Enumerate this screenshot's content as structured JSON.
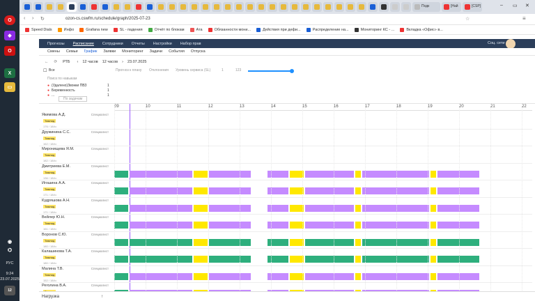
{
  "taskbar": {
    "lang": "РУС",
    "time": "9:24",
    "date": "23.07.2025",
    "notif": "12"
  },
  "browser": {
    "url": "ozon-cs.cswfm.ru/schedule/graph/2025-07-23",
    "tab_title_1": "Подк",
    "tab_title_2": "[Най",
    "tab_title_3": "[CSP]",
    "bookmarks": [
      {
        "label": "Speed Dials",
        "color": "#e33"
      },
      {
        "label": "Инфо",
        "color": "#f90"
      },
      {
        "label": "Grafana new",
        "color": "#f60"
      },
      {
        "label": "SL - падения",
        "color": "#e33"
      },
      {
        "label": "Отчёт по блокам",
        "color": "#4a4"
      },
      {
        "label": "Ата",
        "color": "#e55"
      },
      {
        "label": "Обязанности мони...",
        "color": "#e33"
      },
      {
        "label": "Действия при дефи...",
        "color": "#1a5fd6"
      },
      {
        "label": "Распределение на...",
        "color": "#1a5fd6"
      },
      {
        "label": "Мониторинг КС - ...",
        "color": "#333"
      },
      {
        "label": "Вкладка «Офис» в...",
        "color": "#e33"
      }
    ]
  },
  "app": {
    "nav": [
      "Прогнозы",
      "Расписание",
      "Сотрудники",
      "Отчеты",
      "Настройки",
      "Набор прав"
    ],
    "user": "Соц. сети",
    "menu": [
      "Смены",
      "Семьи",
      "График",
      "Заявки",
      "Мониторинг",
      "Задачи",
      "События",
      "Отпуска"
    ],
    "toolbar": {
      "rtb": "РТБ",
      "hours_a": "12 часов",
      "hours_b": "12 часов",
      "date": "23.07.2025"
    },
    "filters": {
      "all": "Все",
      "search_placeholder": "Поиск по навыкам",
      "forecast": "Прогноз к плану",
      "deviations": "Отклонения",
      "service": "Уровень сервиса (SL)",
      "opt1": "1",
      "opt2": "123",
      "items": [
        {
          "label": "(Удалено)Звонки ПВЗ",
          "count": "1"
        },
        {
          "label": "Беременность",
          "count": "1"
        },
        {
          "label": "...",
          "count": "1"
        }
      ],
      "search": "По задачам"
    },
    "hours": [
      "09",
      "10",
      "11",
      "12",
      "13",
      "14",
      "15",
      "16",
      "17",
      "18",
      "19",
      "20",
      "21",
      "22"
    ],
    "employees": [
      {
        "name": "Якимова А.Д.",
        "tag": "Тимлид",
        "meta": "176 / 184ч",
        "role": "Специалист"
      },
      {
        "name": "Дружинина С.С.",
        "tag": "Тимлид",
        "meta": "162 / 184ч",
        "role": "Специалист"
      },
      {
        "name": "Миронищева Я.М.",
        "tag": "Тимлид",
        "meta": "182 / 184ч",
        "role": "Специалист"
      },
      {
        "name": "Дмитриева Е.М.",
        "tag": "Тимлид",
        "meta": "136 / 184ч",
        "role": "Специалист"
      },
      {
        "name": "Игошина А.А.",
        "tag": "Тимлид",
        "meta": "171 / 184ч",
        "role": "Специалист"
      },
      {
        "name": "Кудряшова А.Н.",
        "tag": "Тимлид",
        "meta": "171 / 184ч",
        "role": "Специалист"
      },
      {
        "name": "Вейлер Ю.Н.",
        "tag": "Тимлид",
        "meta": "161 / 184ч",
        "role": "Специалист"
      },
      {
        "name": "Воронов С.Ю.",
        "tag": "Тимлид",
        "meta": "180 / 184ч",
        "role": "Специалист"
      },
      {
        "name": "Калашинова Т.А.",
        "tag": "Тимлид",
        "meta": "180 / 184ч",
        "role": "Специалист"
      },
      {
        "name": "Малина Т.В.",
        "tag": "Тимлид",
        "meta": "152 / 184ч",
        "role": "Специалист"
      },
      {
        "name": "Реголина В.А.",
        "tag": "Тимлид",
        "meta": "180 / 184ч",
        "role": "Специалист"
      }
    ],
    "footer": "Нагрузка"
  }
}
